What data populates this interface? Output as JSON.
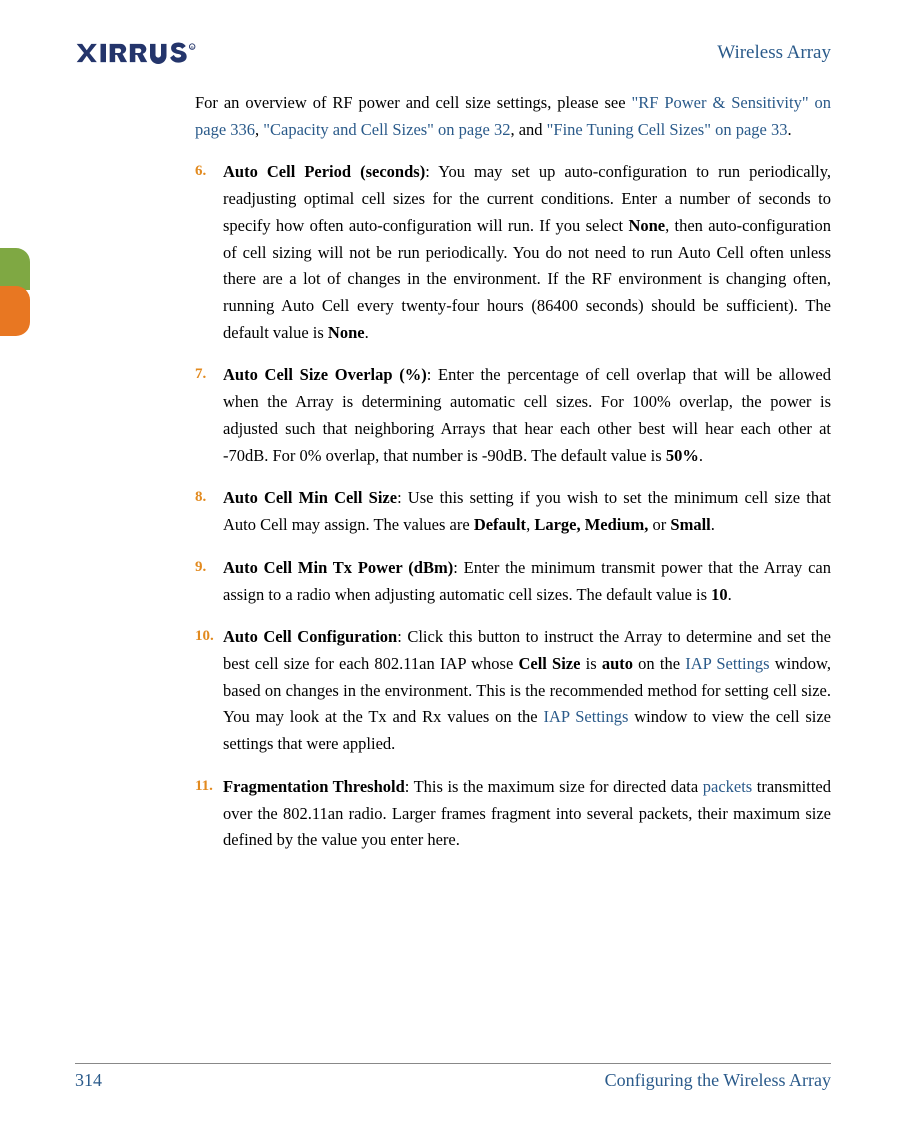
{
  "header": {
    "title": "Wireless Array"
  },
  "intro": {
    "prefix": "For an overview of RF power and cell size settings, please see ",
    "link1": "\"RF Power & Sensitivity\" on page 336",
    "sep1": ", ",
    "link2": "\"Capacity and Cell Sizes\" on page 32",
    "sep2": ", and ",
    "link3": "\"Fine Tuning Cell Sizes\" on page 33",
    "suffix": "."
  },
  "items": [
    {
      "number": "6.",
      "title": "Auto Cell Period (seconds)",
      "body_raw": ": You may set up auto-configuration to run periodically, readjusting optimal cell sizes for the current conditions. Enter a number of seconds to specify how often auto-configuration will run. If you select <b>None</b>, then auto-configuration of cell sizing will not be run periodically. You do not need to run Auto Cell often unless there are a lot of changes in the environment. If the RF environment is changing often, running Auto Cell every twenty-four hours (86400 seconds) should be sufficient). The default value is <b>None</b>."
    },
    {
      "number": "7.",
      "title": "Auto Cell Size Overlap (%)",
      "body_raw": ": Enter the percentage of cell overlap that will be allowed when the Array is determining automatic cell sizes. For 100% overlap, the power is adjusted such that neighboring Arrays that hear each other best will hear each other at -70dB. For 0% overlap, that number is -90dB. The default value is <b>50%</b>."
    },
    {
      "number": "8.",
      "title": "Auto Cell Min Cell Size",
      "body_raw": ": Use this setting if you wish to set the minimum cell size that Auto Cell may assign. The values are <b>Default</b>, <b>Large, Medium,</b> or <b>Small</b>."
    },
    {
      "number": "9.",
      "title": "Auto Cell Min Tx Power (dBm)",
      "body_raw": ": Enter the minimum transmit power that the Array can assign to a radio when adjusting automatic cell sizes. The default value is <b>10</b>."
    },
    {
      "number": "10.",
      "title": "Auto Cell Configuration",
      "body_raw": ": Click this button to instruct the Array to determine and set the best cell size for each 802.11an IAP whose <b>Cell Size</b> is <b>auto</b> on the <span class=\"link\">IAP Settings</span> window, based on changes in the environment. This is the recommended method for setting cell size. You may look at the Tx and Rx values on the <span class=\"link\">IAP Settings</span> window to view the cell size settings that were applied."
    },
    {
      "number": "11.",
      "title": "Fragmentation Threshold",
      "body_raw": ": This is the maximum size for directed data <span class=\"link\">packets</span> transmitted over the 802.11an radio. Larger frames fragment into several packets, their maximum size defined by the value you enter here."
    }
  ],
  "footer": {
    "page_number": "314",
    "section": "Configuring the Wireless Array"
  }
}
